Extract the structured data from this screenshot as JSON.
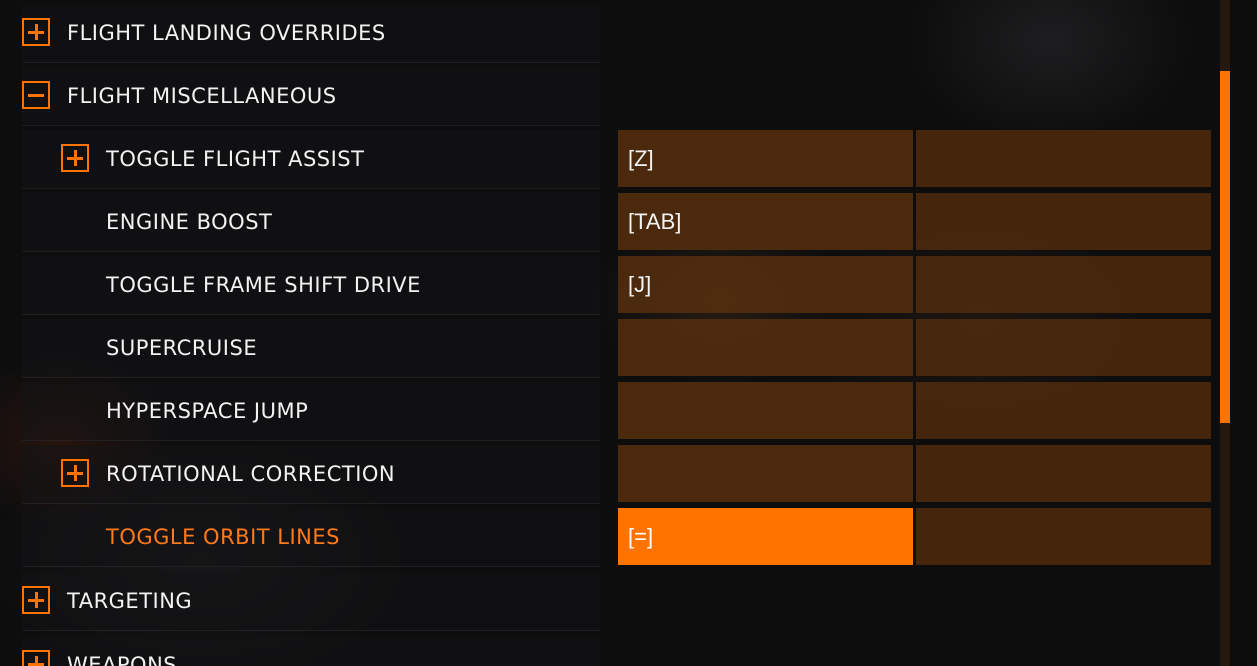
{
  "accent": "#ff7400",
  "rows": [
    {
      "label": "FLIGHT LANDING OVERRIDES",
      "icon": "plus-box-icon",
      "level": 0
    },
    {
      "label": "FLIGHT MISCELLANEOUS",
      "icon": "minus-box-icon",
      "level": 0
    },
    {
      "label": "TOGGLE FLIGHT ASSIST",
      "icon": "plus-box-icon",
      "level": 1,
      "primary": "[Z]",
      "secondary": ""
    },
    {
      "label": "ENGINE BOOST",
      "level": 1,
      "primary": "[TAB]",
      "secondary": ""
    },
    {
      "label": "TOGGLE FRAME SHIFT DRIVE",
      "level": 1,
      "primary": "[J]",
      "secondary": ""
    },
    {
      "label": "SUPERCRUISE",
      "level": 1,
      "primary": "",
      "secondary": ""
    },
    {
      "label": "HYPERSPACE JUMP",
      "level": 1,
      "primary": "",
      "secondary": ""
    },
    {
      "label": "ROTATIONAL CORRECTION",
      "icon": "plus-box-icon",
      "level": 1,
      "primary": "",
      "secondary": ""
    },
    {
      "label": "TOGGLE ORBIT LINES",
      "level": 1,
      "primary": "[=]",
      "secondary": "",
      "active": true
    },
    {
      "label": "TARGETING",
      "icon": "plus-box-icon",
      "level": 0
    },
    {
      "label": "WEAPONS",
      "icon": "plus-box-icon",
      "level": 0
    }
  ]
}
